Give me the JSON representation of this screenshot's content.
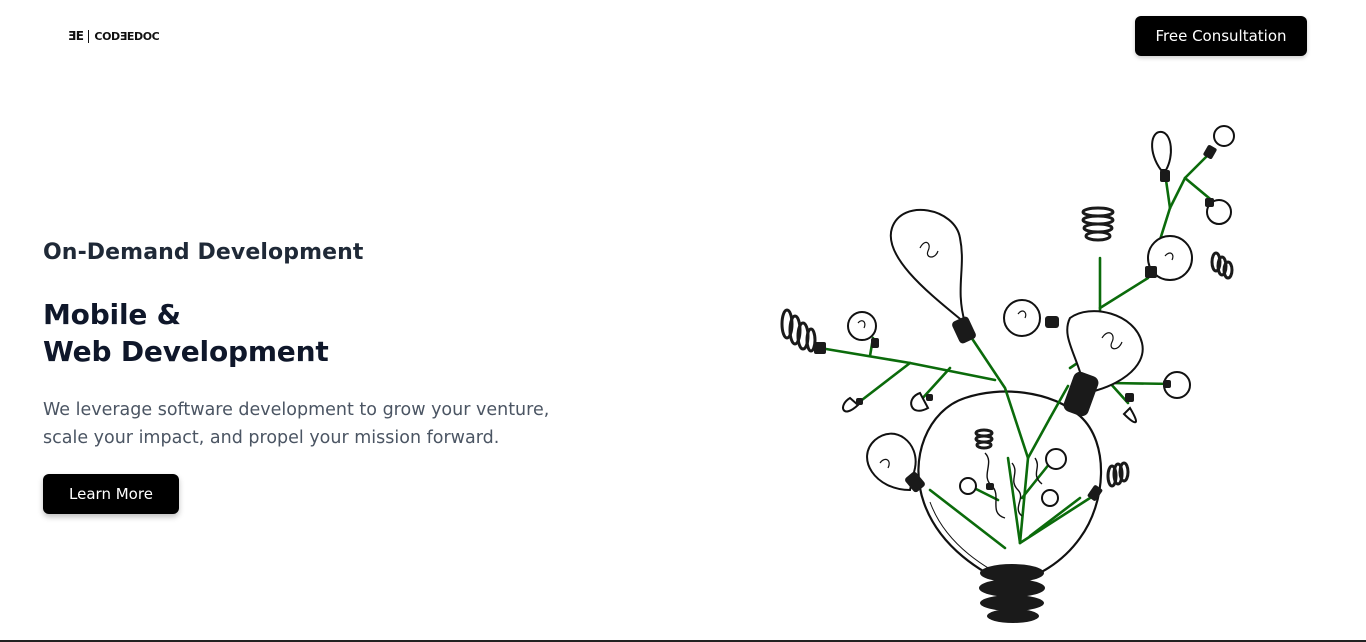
{
  "header": {
    "logo_mark": "ƎE",
    "logo_text": "CODƎEDOC",
    "cta_label": "Free Consultation"
  },
  "hero": {
    "eyebrow": "On-Demand Development",
    "title_line1": "Mobile &",
    "title_line2": "Web Development",
    "desc_line1": "We leverage software development to grow your venture,",
    "desc_line2": "scale your impact, and propel your mission forward.",
    "cta_label": "Learn More"
  },
  "illustration": {
    "icon": "lightbulb-tree-illustration",
    "branch_color": "#0b6b0b",
    "ink_color": "#111111"
  }
}
